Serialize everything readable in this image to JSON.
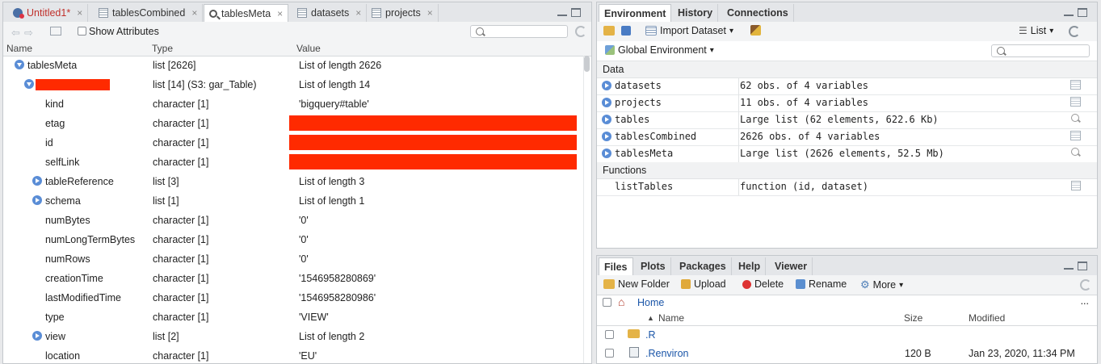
{
  "left": {
    "tabs": [
      {
        "label": "Untitled1*",
        "unsaved": true
      },
      {
        "label": "tablesCombined"
      },
      {
        "label": "tablesMeta",
        "active": true
      },
      {
        "label": "datasets"
      },
      {
        "label": "projects"
      }
    ],
    "close_glyph": "×",
    "show_attributes_label": "Show Attributes",
    "columns": {
      "name": "Name",
      "type": "Type",
      "value": "Value"
    },
    "rows": [
      {
        "name": "tablesMeta",
        "type": "list [2626]",
        "value": "List of length 2626",
        "level": 0,
        "expander": "open"
      },
      {
        "name": "",
        "type": "list [14] (S3: gar_Table)",
        "value": "List of length 14",
        "level": 1,
        "expander": "open",
        "redact_name": true
      },
      {
        "name": "kind",
        "type": "character [1]",
        "value": "'bigquery#table'",
        "level": 2
      },
      {
        "name": "etag",
        "type": "character [1]",
        "value": "",
        "level": 2,
        "redact_value": true
      },
      {
        "name": "id",
        "type": "character [1]",
        "value": "",
        "level": 2,
        "redact_value": true
      },
      {
        "name": "selfLink",
        "type": "character [1]",
        "value": "",
        "level": 2,
        "redact_value": true
      },
      {
        "name": "tableReference",
        "type": "list [3]",
        "value": "List of length 3",
        "level": 2,
        "expander": "closed"
      },
      {
        "name": "schema",
        "type": "list [1]",
        "value": "List of length 1",
        "level": 2,
        "expander": "closed"
      },
      {
        "name": "numBytes",
        "type": "character [1]",
        "value": "'0'",
        "level": 2
      },
      {
        "name": "numLongTermBytes",
        "type": "character [1]",
        "value": "'0'",
        "level": 2
      },
      {
        "name": "numRows",
        "type": "character [1]",
        "value": "'0'",
        "level": 2
      },
      {
        "name": "creationTime",
        "type": "character [1]",
        "value": "'1546958280869'",
        "level": 2
      },
      {
        "name": "lastModifiedTime",
        "type": "character [1]",
        "value": "'1546958280986'",
        "level": 2
      },
      {
        "name": "type",
        "type": "character [1]",
        "value": "'VIEW'",
        "level": 2
      },
      {
        "name": "view",
        "type": "list [2]",
        "value": "List of length 2",
        "level": 2,
        "expander": "closed"
      },
      {
        "name": "location",
        "type": "character [1]",
        "value": "'EU'",
        "level": 2
      }
    ]
  },
  "env": {
    "tabs": [
      {
        "label": "Environment",
        "active": true
      },
      {
        "label": "History"
      },
      {
        "label": "Connections"
      }
    ],
    "import_label": "Import Dataset",
    "list_label": "List",
    "global_env_label": "Global Environment",
    "dropdown_glyph": "▾",
    "sections": [
      {
        "title": "Data",
        "rows": [
          {
            "name": "datasets",
            "value": "62 obs. of 4 variables",
            "icon": "grid"
          },
          {
            "name": "projects",
            "value": "11 obs. of 4 variables",
            "icon": "grid"
          },
          {
            "name": "tables",
            "value": "Large list (62 elements, 622.6 Kb)",
            "icon": "search"
          },
          {
            "name": "tablesCombined",
            "value": "2626 obs. of 4 variables",
            "icon": "grid"
          },
          {
            "name": "tablesMeta",
            "value": "Large list (2626 elements, 52.5 Mb)",
            "icon": "search"
          }
        ]
      },
      {
        "title": "Functions",
        "rows": [
          {
            "name": "listTables",
            "value": "function (id, dataset)",
            "icon": "doc"
          }
        ]
      }
    ]
  },
  "files": {
    "tabs": [
      {
        "label": "Files",
        "active": true
      },
      {
        "label": "Plots"
      },
      {
        "label": "Packages"
      },
      {
        "label": "Help"
      },
      {
        "label": "Viewer"
      }
    ],
    "toolbar": {
      "new_folder": "New Folder",
      "upload": "Upload",
      "delete": "Delete",
      "rename": "Rename",
      "more": "More"
    },
    "breadcrumb": "Home",
    "ellipsis": "...",
    "columns": {
      "sort_glyph": "▲",
      "name": "Name",
      "size": "Size",
      "modified": "Modified"
    },
    "rows": [
      {
        "name": ".R",
        "size": "",
        "modified": "",
        "kind": "folder"
      },
      {
        "name": ".Renviron",
        "size": "120 B",
        "modified": "Jan 23, 2020, 11:34 PM",
        "kind": "file"
      }
    ]
  },
  "colors": {
    "accent": "#5a8dd6",
    "redaction": "#ff2a00",
    "link": "#1a55a8",
    "unsaved": "#c0302b"
  }
}
